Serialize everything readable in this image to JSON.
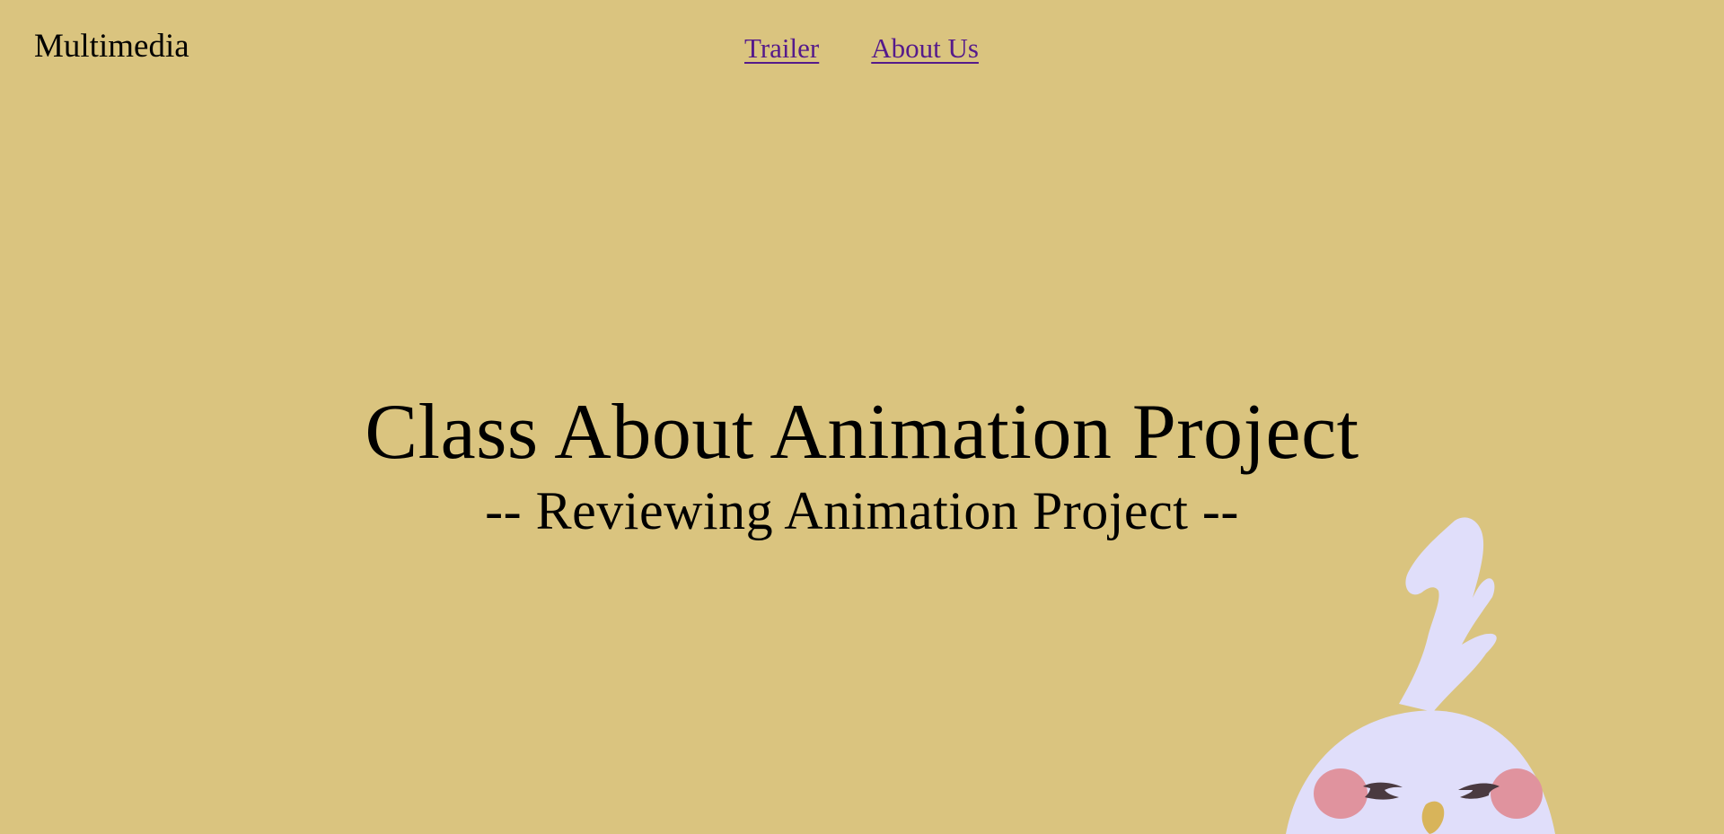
{
  "header": {
    "brand": "Multimedia",
    "nav": [
      {
        "label": "Trailer"
      },
      {
        "label": "About Us"
      }
    ]
  },
  "hero": {
    "title": "Class About Animation Project",
    "subtitle": "-- Reviewing Animation Project --"
  },
  "colors": {
    "background": "#dac47f",
    "link": "#551a8b",
    "mascot_body": "#e0defa",
    "mascot_cheek": "#e0939e",
    "mascot_eye": "#4a3a40",
    "mascot_beak": "#d8b45a"
  }
}
